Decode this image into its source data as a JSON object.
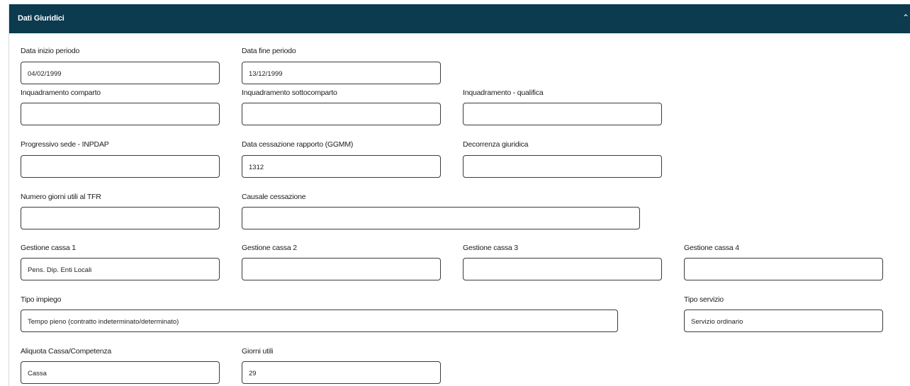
{
  "section": {
    "title": "Dati Giuridici",
    "collapse_icon": "chevron-up-icon"
  },
  "fields": {
    "data_inizio": {
      "label": "Data inizio periodo",
      "value": "04/02/1999"
    },
    "data_fine": {
      "label": "Data fine periodo",
      "value": "13/12/1999"
    },
    "inq_comparto": {
      "label": "Inquadramento comparto",
      "value": ""
    },
    "inq_sottocomparto": {
      "label": "Inquadramento sottocomparto",
      "value": ""
    },
    "inq_qualifica": {
      "label": "Inquadramento - qualifica",
      "value": ""
    },
    "progressivo_sede": {
      "label": "Progressivo sede - INPDAP",
      "value": ""
    },
    "data_cessazione": {
      "label": "Data cessazione rapporto (GGMM)",
      "value": "1312"
    },
    "decorrenza": {
      "label": "Decorrenza giuridica",
      "value": ""
    },
    "giorni_tfr": {
      "label": "Numero giorni utili al TFR",
      "value": ""
    },
    "causale": {
      "label": "Causale cessazione",
      "value": ""
    },
    "cassa1": {
      "label": "Gestione cassa 1",
      "value": "Pens. Dip. Enti Locali"
    },
    "cassa2": {
      "label": "Gestione cassa 2",
      "value": ""
    },
    "cassa3": {
      "label": "Gestione cassa 3",
      "value": ""
    },
    "cassa4": {
      "label": "Gestione cassa 4",
      "value": ""
    },
    "tipo_impiego": {
      "label": "Tipo impiego",
      "value": "Tempo pieno (contratto indeterminato/determinato)"
    },
    "tipo_servizio": {
      "label": "Tipo servizio",
      "value": "Servizio ordinario"
    },
    "aliquota": {
      "label": "Aliquota Cassa/Competenza",
      "value": "Cassa"
    },
    "giorni_utili": {
      "label": "Giorni utili",
      "value": "29"
    }
  }
}
